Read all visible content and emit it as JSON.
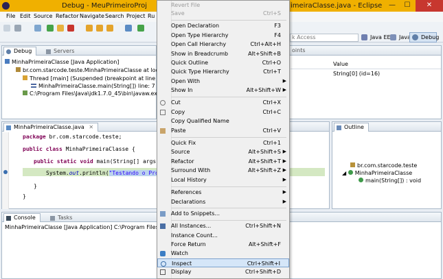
{
  "window": {
    "title_left": "Debug - MeuPrimeiroProj",
    "title_right": "imeiraClasse.java - Eclipse",
    "min": "—",
    "max": "☐",
    "close": "✕"
  },
  "menubar": [
    "File",
    "Edit",
    "Source",
    "Refactor",
    "Navigate",
    "Search",
    "Project",
    "Ru"
  ],
  "toolbar": {
    "quick_access": "k Access",
    "perspectives": [
      "Java EE",
      "Java",
      "Debug"
    ]
  },
  "debug_view": {
    "tabs": [
      "Debug",
      "Servers"
    ],
    "tree": [
      "MinhaPrimeiraClasse [Java Application]",
      "br.com.starcode.teste.MinhaPrimeiraClasse at localhos",
      "Thread [main] (Suspended (breakpoint at line 7 in M",
      "MinhaPrimeiraClasse.main(String[]) line: 7",
      "C:\\Program Files\\Java\\jdk1.7.0_45\\bin\\javaw.exe (27/11"
    ]
  },
  "variables_view": {
    "tab_fragment": "oints",
    "header_value": "Value",
    "row_value": "String[0]  (id=16)"
  },
  "editor": {
    "tab": "MinhaPrimeiraClasse.java",
    "lines": {
      "pkg_kw": "package",
      "pkg": " br.com.starcode.teste;",
      "cls_kw": "public class",
      "cls": " MinhaPrimeiraClasse {",
      "main_kw": "public static void",
      "main": " main(String[] args) {",
      "println_a": "System.",
      "println_out": "out",
      "println_b": ".println(",
      "println_str": "\"Testando o Progra",
      "close1": "}",
      "close2": "}"
    }
  },
  "outline": {
    "tab": "Outline",
    "items": [
      "br.com.starcode.teste",
      "MinhaPrimeiraClasse",
      "main(String[]) : void"
    ]
  },
  "console": {
    "tabs": [
      "Console",
      "Tasks"
    ],
    "text": "MinhaPrimeiraClasse [Java Application] C:\\Program Files\\Java\\jdk"
  },
  "context_menu": {
    "items": [
      {
        "label": "Revert File",
        "shortcut": "",
        "disabled": true
      },
      {
        "label": "Save",
        "shortcut": "Ctrl+S",
        "disabled": true
      },
      {
        "label": "Open Declaration",
        "shortcut": "F3"
      },
      {
        "label": "Open Type Hierarchy",
        "shortcut": "F4"
      },
      {
        "label": "Open Call Hierarchy",
        "shortcut": "Ctrl+Alt+H"
      },
      {
        "label": "Show in Breadcrumb",
        "shortcut": "Alt+Shift+B"
      },
      {
        "label": "Quick Outline",
        "shortcut": "Ctrl+O"
      },
      {
        "label": "Quick Type Hierarchy",
        "shortcut": "Ctrl+T"
      },
      {
        "label": "Open With",
        "shortcut": "",
        "submenu": true
      },
      {
        "label": "Show In",
        "shortcut": "Alt+Shift+W",
        "submenu": true
      },
      {
        "label": "Cut",
        "shortcut": "Ctrl+X"
      },
      {
        "label": "Copy",
        "shortcut": "Ctrl+C"
      },
      {
        "label": "Copy Qualified Name",
        "shortcut": ""
      },
      {
        "label": "Paste",
        "shortcut": "Ctrl+V"
      },
      {
        "label": "Quick Fix",
        "shortcut": "Ctrl+1"
      },
      {
        "label": "Source",
        "shortcut": "Alt+Shift+S",
        "submenu": true
      },
      {
        "label": "Refactor",
        "shortcut": "Alt+Shift+T",
        "submenu": true
      },
      {
        "label": "Surround With",
        "shortcut": "Alt+Shift+Z",
        "submenu": true
      },
      {
        "label": "Local History",
        "shortcut": "",
        "submenu": true
      },
      {
        "label": "References",
        "shortcut": "",
        "submenu": true
      },
      {
        "label": "Declarations",
        "shortcut": "",
        "submenu": true
      },
      {
        "label": "Add to Snippets...",
        "shortcut": ""
      },
      {
        "label": "All Instances...",
        "shortcut": "Ctrl+Shift+N"
      },
      {
        "label": "Instance Count...",
        "shortcut": ""
      },
      {
        "label": "Force Return",
        "shortcut": "Alt+Shift+F"
      },
      {
        "label": "Watch",
        "shortcut": ""
      },
      {
        "label": "Inspect",
        "shortcut": "Ctrl+Shift+I",
        "highlighted": true
      },
      {
        "label": "Display",
        "shortcut": "Ctrl+Shift+D"
      }
    ]
  },
  "colors": {
    "title_bar": "#f0b000",
    "menu_highlight": "#d5e6f8",
    "keyword": "#7f0055",
    "string": "#2a00ff"
  }
}
